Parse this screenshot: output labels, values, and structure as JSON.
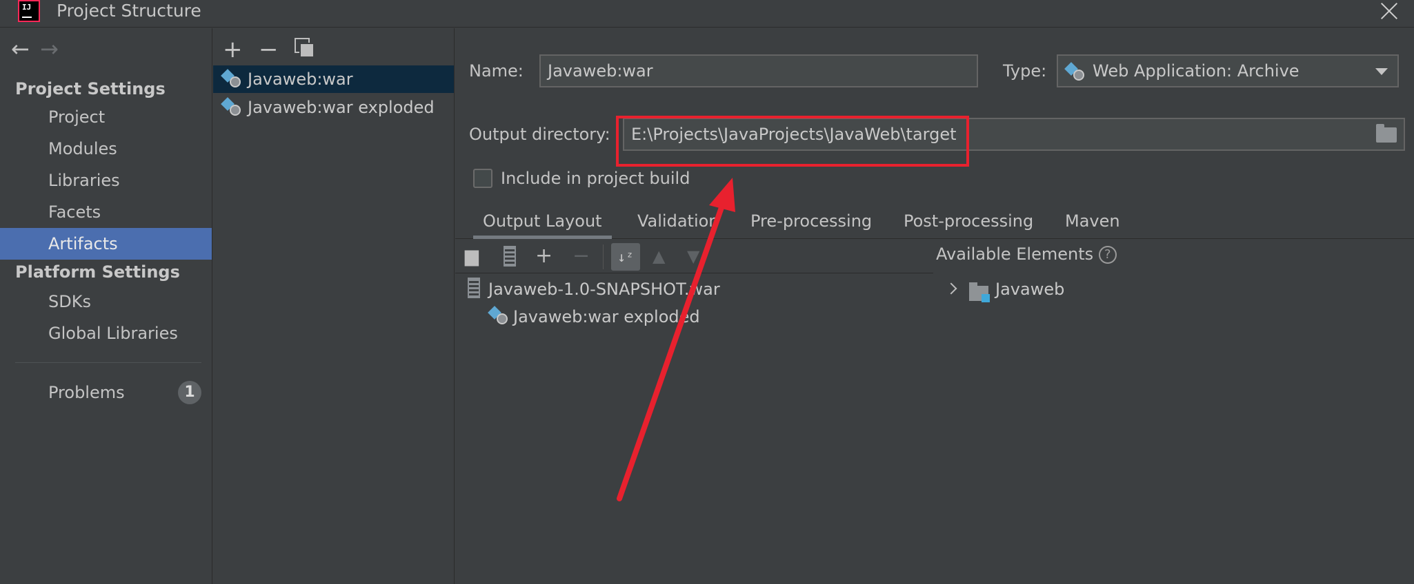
{
  "window": {
    "title": "Project Structure"
  },
  "sidebar": {
    "project_settings_label": "Project Settings",
    "project_items": [
      "Project",
      "Modules",
      "Libraries",
      "Facets",
      "Artifacts"
    ],
    "platform_settings_label": "Platform Settings",
    "platform_items": [
      "SDKs",
      "Global Libraries"
    ],
    "problems_label": "Problems",
    "problems_count": "1",
    "selected": "Artifacts"
  },
  "artifacts": {
    "items": [
      "Javaweb:war",
      "Javaweb:war exploded"
    ],
    "selected": "Javaweb:war"
  },
  "main": {
    "name_label": "Name:",
    "name_value": "Javaweb:war",
    "type_label": "Type:",
    "type_value": "Web Application: Archive",
    "output_dir_label": "Output directory:",
    "output_dir_value": "E:\\Projects\\JavaProjects\\JavaWeb\\target",
    "include_label": "Include in project build",
    "include_checked": false,
    "tabs": [
      "Output Layout",
      "Validation",
      "Pre-processing",
      "Post-processing",
      "Maven"
    ],
    "active_tab": "Output Layout",
    "layout_tree": {
      "root": "Javaweb-1.0-SNAPSHOT.war",
      "child": "Javaweb:war exploded"
    },
    "available_label": "Available Elements",
    "available_items": [
      "Javaweb"
    ]
  },
  "colors": {
    "background": "#3c3f41",
    "selection": "#4b6eaf",
    "annotation": "#e8212e"
  }
}
